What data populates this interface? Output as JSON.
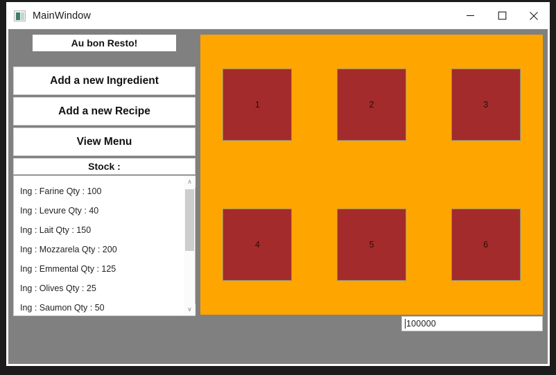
{
  "window": {
    "title": "MainWindow",
    "icon": "app-window-icon",
    "controls": [
      {
        "name": "minimize-button",
        "glyph": "minimize-icon",
        "label": "Minimize"
      },
      {
        "name": "maximize-button",
        "glyph": "maximize-icon",
        "label": "Maximize"
      },
      {
        "name": "close-button",
        "glyph": "close-icon",
        "label": "Close"
      }
    ]
  },
  "sidebar": {
    "brand": "Au bon Resto!",
    "buttons": [
      {
        "label": "Add a new Ingredient",
        "name": "add-ingredient-button"
      },
      {
        "label": "Add a new Recipe",
        "name": "add-recipe-button"
      },
      {
        "label": "View Menu",
        "name": "view-menu-button"
      }
    ],
    "stock_label": "Stock :",
    "stock_items": [
      "Ing :  Farine Qty :  100",
      "Ing :  Levure Qty :  40",
      "Ing :  Lait Qty :  150",
      "Ing :  Mozzarela Qty :  200",
      "Ing :  Emmental Qty :  125",
      "Ing :  Olives Qty :  25",
      "Ing :  Saumon Qty :  50"
    ],
    "scrollbar": {
      "up_glyph": "∧",
      "down_glyph": "∨"
    }
  },
  "canvas": {
    "background_color": "#ffa500",
    "tile_color": "#a32b2b",
    "tiles": [
      {
        "label": "1"
      },
      {
        "label": "2"
      },
      {
        "label": "3"
      },
      {
        "label": "4"
      },
      {
        "label": "5"
      },
      {
        "label": "6"
      }
    ]
  },
  "bottom_field": {
    "value": "100000",
    "placeholder": ""
  }
}
